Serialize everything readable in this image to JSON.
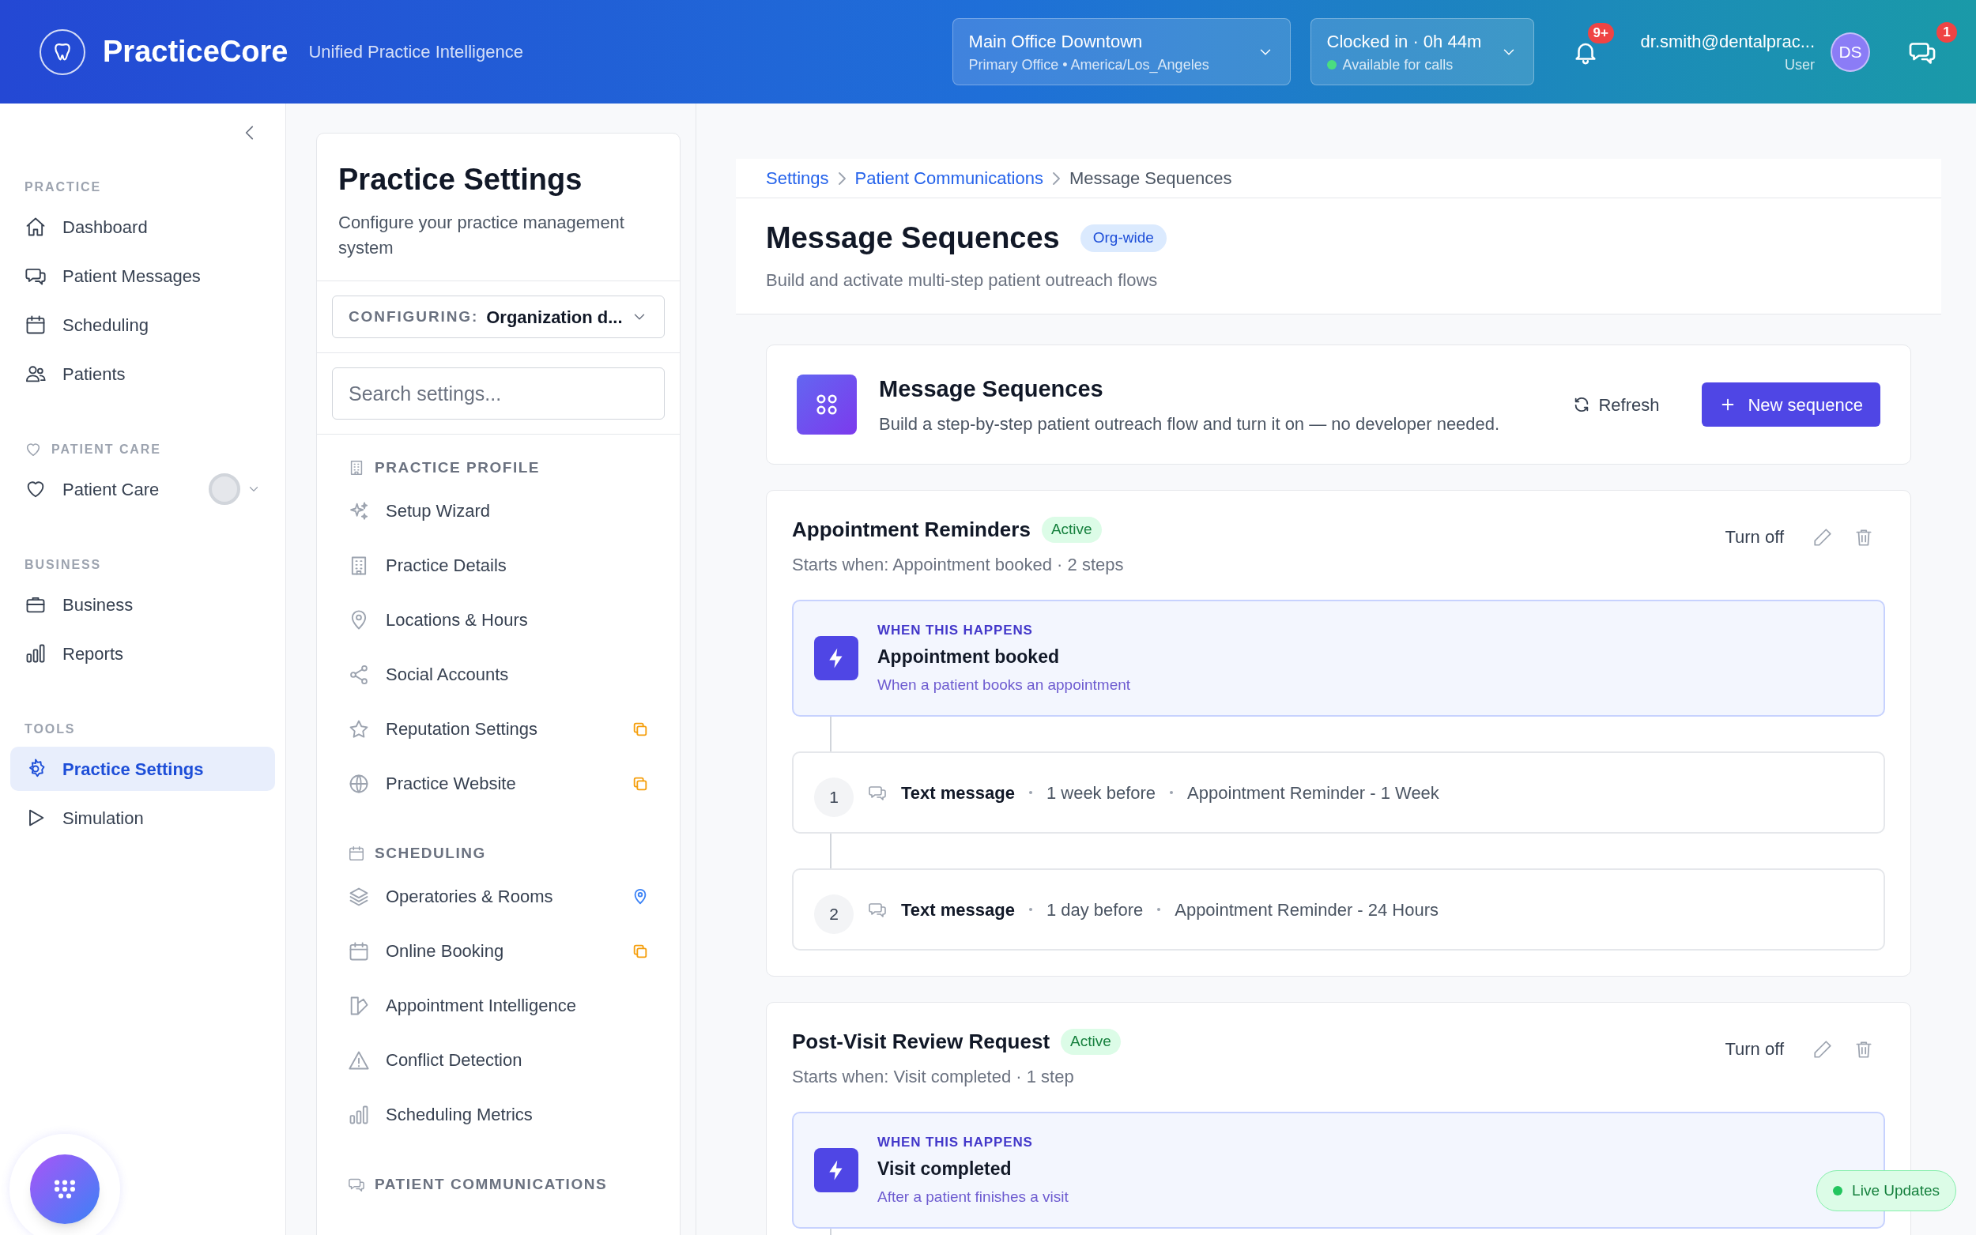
{
  "header": {
    "brand": "PracticeCore",
    "tagline": "Unified Practice Intelligence",
    "location": {
      "name": "Main Office Downtown",
      "detail": "Primary Office • America/Los_Angeles"
    },
    "clock": {
      "status": "Clocked in · 0h 44m",
      "availability": "Available for calls"
    },
    "notifications_badge": "9+",
    "user": {
      "email": "dr.smith@dentalprac...",
      "role": "User",
      "initials": "DS"
    },
    "messages_badge": "1"
  },
  "sidebar": {
    "sections": [
      {
        "title": "PRACTICE",
        "items": [
          {
            "label": "Dashboard",
            "selected": false
          },
          {
            "label": "Patient Messages",
            "selected": false
          },
          {
            "label": "Scheduling",
            "selected": false
          },
          {
            "label": "Patients",
            "selected": false
          }
        ]
      },
      {
        "title": "PATIENT CARE",
        "items": [
          {
            "label": "Patient Care",
            "selected": false,
            "expanded": false
          }
        ]
      },
      {
        "title": "BUSINESS",
        "items": [
          {
            "label": "Business",
            "selected": false
          },
          {
            "label": "Reports",
            "selected": false
          }
        ]
      },
      {
        "title": "TOOLS",
        "items": [
          {
            "label": "Practice Settings",
            "selected": true
          },
          {
            "label": "Simulation",
            "selected": false
          }
        ]
      }
    ]
  },
  "settings": {
    "title": "Practice Settings",
    "subtitle": "Configure your practice management system",
    "configuring": {
      "label": "CONFIGURING:",
      "value": "Organization d..."
    },
    "search": {
      "placeholder": "Search settings..."
    },
    "groups": [
      {
        "title": "PRACTICE PROFILE",
        "items": [
          {
            "label": "Setup Wizard",
            "kind": "plain"
          },
          {
            "label": "Practice Details",
            "kind": "plain"
          },
          {
            "label": "Locations & Hours",
            "kind": "plain"
          },
          {
            "label": "Social Accounts",
            "kind": "plain"
          },
          {
            "label": "Reputation Settings",
            "kind": "copy"
          },
          {
            "label": "Practice Website",
            "kind": "copy"
          }
        ]
      },
      {
        "title": "SCHEDULING",
        "items": [
          {
            "label": "Operatories & Rooms",
            "kind": "pin"
          },
          {
            "label": "Online Booking",
            "kind": "copy"
          },
          {
            "label": "Appointment Intelligence",
            "kind": "plain"
          },
          {
            "label": "Conflict Detection",
            "kind": "plain"
          },
          {
            "label": "Scheduling Metrics",
            "kind": "plain"
          }
        ]
      },
      {
        "title": "PATIENT COMMUNICATIONS"
      }
    ]
  },
  "main": {
    "breadcrumb": [
      {
        "label": "Settings",
        "link": true
      },
      {
        "label": "Patient Communications",
        "link": true
      },
      {
        "label": "Message Sequences",
        "link": false
      }
    ],
    "title": "Message Sequences",
    "scope": "Org-wide",
    "subtitle": "Build and activate multi-step patient outreach flows",
    "intro": {
      "title": "Message Sequences",
      "description": "Build a step-by-step patient outreach flow and turn it on — no developer needed.",
      "refresh": "Refresh",
      "new_button": "New sequence"
    },
    "sequences": [
      {
        "name": "Appointment Reminders",
        "status": "Active",
        "summary": "Starts when: Appointment booked · 2 steps",
        "toggle": "Turn off",
        "trigger": {
          "heading": "WHEN THIS HAPPENS",
          "name": "Appointment booked",
          "description": "When a patient books an appointment"
        },
        "steps": [
          {
            "number": "1",
            "channel": "Text message",
            "timing": "1 week before",
            "template": "Appointment Reminder - 1 Week"
          },
          {
            "number": "2",
            "channel": "Text message",
            "timing": "1 day before",
            "template": "Appointment Reminder - 24 Hours"
          }
        ]
      },
      {
        "name": "Post-Visit Review Request",
        "status": "Active",
        "summary": "Starts when: Visit completed · 1 step",
        "toggle": "Turn off",
        "trigger": {
          "heading": "WHEN THIS HAPPENS",
          "name": "Visit completed",
          "description": "After a patient finishes a visit"
        }
      }
    ]
  },
  "live_updates": "Live Updates"
}
